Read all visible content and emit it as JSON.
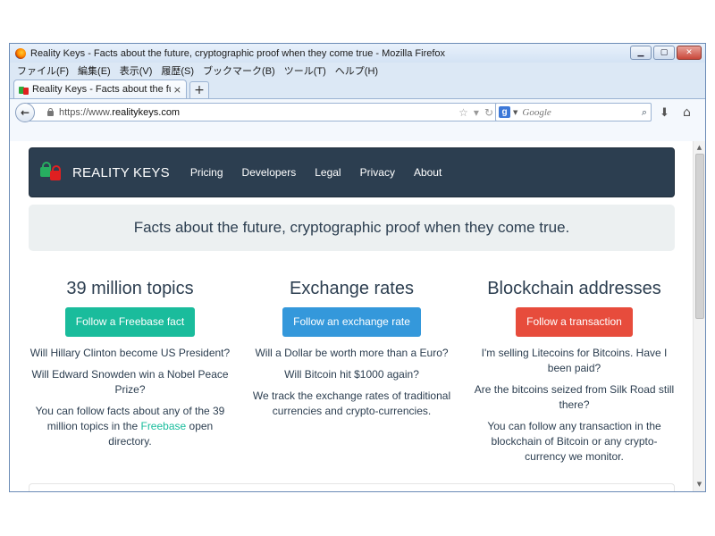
{
  "window": {
    "title": "Reality Keys - Facts about the future, cryptographic proof when they come true - Mozilla Firefox",
    "controls": {
      "minimize": "▁",
      "maximize": "▢",
      "close": "✕"
    }
  },
  "menubar": {
    "items": [
      "ファイル(F)",
      "編集(E)",
      "表示(V)",
      "履歴(S)",
      "ブックマーク(B)",
      "ツール(T)",
      "ヘルプ(H)"
    ]
  },
  "tabs": {
    "active_label": "Reality Keys - Facts about the futur...",
    "close": "×",
    "new_tab": "+"
  },
  "navbar": {
    "back": "←",
    "url_scheme": "https://www.",
    "url_host": "realitykeys.com",
    "search_placeholder": "Google",
    "search_engine_letter": "g"
  },
  "site": {
    "brand": "REALITY KEYS",
    "nav": [
      "Pricing",
      "Developers",
      "Legal",
      "Privacy",
      "About"
    ],
    "hero": "Facts about the future, cryptographic proof when they come true.",
    "columns": [
      {
        "title": "39 million topics",
        "button": "Follow a Freebase fact",
        "p1": "Will Hillary Clinton become US President?",
        "p2": "Will Edward Snowden win a Nobel Peace Prize?",
        "p3_before": "You can follow facts about any of the 39 million topics in the ",
        "p3_link": "Freebase",
        "p3_after": " open directory."
      },
      {
        "title": "Exchange rates",
        "button": "Follow an exchange rate",
        "p1": "Will a Dollar be worth more than a Euro?",
        "p2": "Will Bitcoin hit $1000 again?",
        "p3": "We track the exchange rates of traditional currencies and crypto-currencies."
      },
      {
        "title": "Blockchain addresses",
        "button": "Follow a transaction",
        "p1": "I'm selling Litecoins for Bitcoins. Have I been paid?",
        "p2": "Are the bitcoins seized from Silk Road still there?",
        "p3": "You can follow any transaction in the blockchain of Bitcoin or any crypto-currency we monitor."
      }
    ]
  },
  "colors": {
    "navbar_bg": "#2c3e50",
    "hero_bg": "#ecf0f1",
    "green": "#1abc9c",
    "blue": "#3498db",
    "red": "#e74c3c"
  }
}
